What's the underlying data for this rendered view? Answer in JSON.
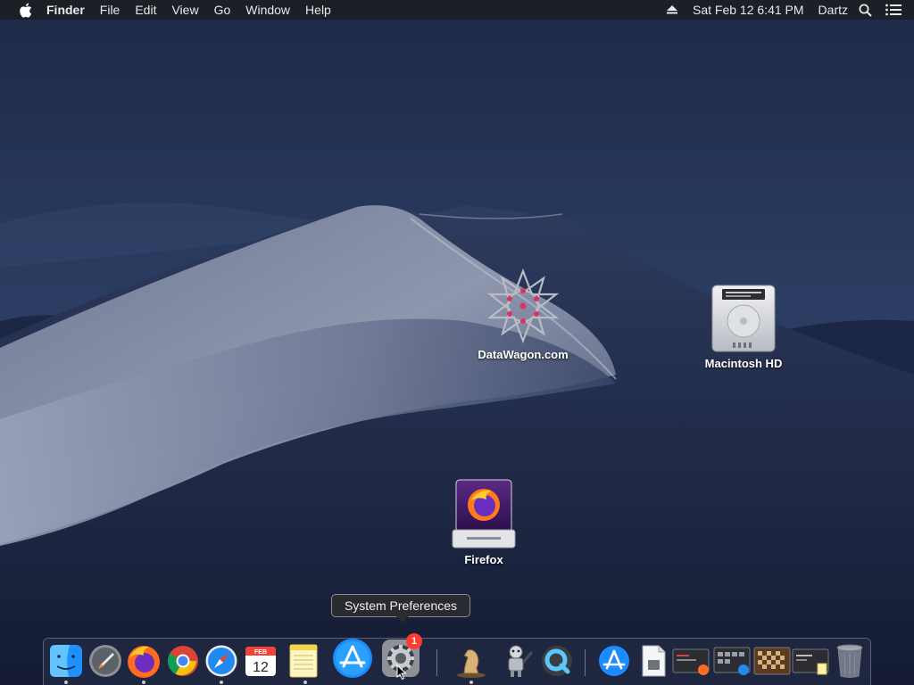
{
  "menubar": {
    "app_name": "Finder",
    "menus": [
      "File",
      "Edit",
      "View",
      "Go",
      "Window",
      "Help"
    ],
    "clock": "Sat Feb 12  6:41 PM",
    "user": "Dartz",
    "icons": [
      "apple-icon",
      "eject-icon",
      "spotlight-search-icon",
      "notification-center-icon"
    ]
  },
  "desktop": {
    "icons": [
      {
        "label": "DataWagon.com",
        "icon": "datawagon-logo-icon"
      },
      {
        "label": "Macintosh HD",
        "icon": "hard-drive-icon"
      },
      {
        "label": "Firefox",
        "icon": "firefox-disk-image-icon"
      }
    ]
  },
  "tooltip": {
    "text": "System Preferences"
  },
  "dock": {
    "items": [
      {
        "name": "finder",
        "icon": "finder-icon",
        "running": true
      },
      {
        "name": "launchpad",
        "icon": "launchpad-icon",
        "running": false
      },
      {
        "name": "firefox",
        "icon": "firefox-icon",
        "running": true
      },
      {
        "name": "chrome",
        "icon": "chrome-icon",
        "running": false
      },
      {
        "name": "safari",
        "icon": "safari-icon",
        "running": true
      },
      {
        "name": "calendar",
        "icon": "calendar-icon",
        "running": false,
        "month": "FEB",
        "day": "12"
      },
      {
        "name": "notes",
        "icon": "notes-icon",
        "running": true
      },
      {
        "name": "app-store",
        "icon": "app-store-icon",
        "running": false
      },
      {
        "name": "system-preferences",
        "icon": "gear-icon",
        "running": false,
        "badge": "1"
      },
      {
        "name": "chess",
        "icon": "chess-knight-icon",
        "running": true
      },
      {
        "name": "automator",
        "icon": "automator-robot-icon",
        "running": false
      },
      {
        "name": "quicktime",
        "icon": "quicktime-icon",
        "running": false
      },
      {
        "name": "app-store-folder",
        "icon": "app-store-icon",
        "running": false
      },
      {
        "name": "document",
        "icon": "document-icon",
        "running": false
      },
      {
        "name": "window-thumb-1",
        "icon": "window-thumbnail-icon",
        "running": false
      },
      {
        "name": "window-thumb-2",
        "icon": "window-thumbnail-icon",
        "running": false
      },
      {
        "name": "window-thumb-3",
        "icon": "chess-board-thumbnail-icon",
        "running": false
      },
      {
        "name": "window-thumb-4",
        "icon": "window-thumbnail-icon",
        "running": false
      },
      {
        "name": "trash",
        "icon": "trash-icon",
        "running": false
      }
    ]
  },
  "colors": {
    "menubar_bg": "#1c1e24",
    "badge": "#ff3b30",
    "dune_light": "#8a93ab",
    "sky_dark": "#1e2c4b"
  }
}
